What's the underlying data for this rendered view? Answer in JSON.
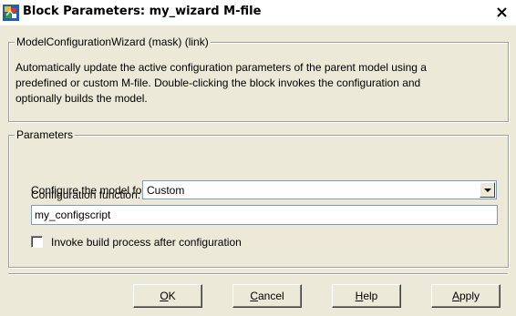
{
  "window": {
    "title": "Block Parameters: my_wizard M-file",
    "icon": "simulink-block-icon",
    "close_glyph": "✕"
  },
  "mask_group": {
    "legend": "ModelConfigurationWizard (mask) (link)",
    "description_lines": [
      "Automatically update the active configuration parameters of the parent model using a",
      "predefined or custom M-file.  Double-clicking the block invokes the configuration and",
      "optionally builds the model."
    ]
  },
  "parameters_group": {
    "legend": "Parameters",
    "configure_label": "Configure the model for:",
    "configure_value": "Custom",
    "function_label": "Configuration function:",
    "function_value": "my_configscript",
    "checkbox_label": "Invoke build process after configuration",
    "checkbox_checked": false
  },
  "buttons": {
    "ok": "OK",
    "cancel": "Cancel",
    "help": "Help",
    "apply": "Apply"
  },
  "colors": {
    "dialog_bg": "#ece9d8",
    "title_text": "#000000",
    "field_border": "#7f9db9"
  }
}
